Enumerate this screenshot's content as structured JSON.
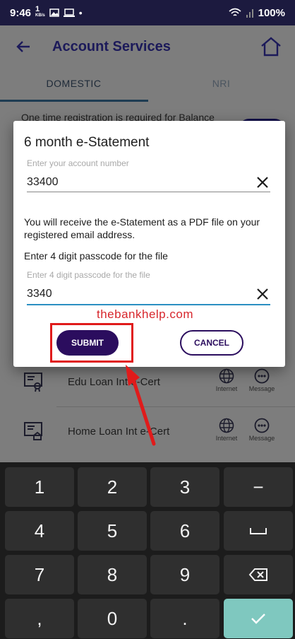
{
  "status_bar": {
    "time": "9:46",
    "speed_unit": "KB/s",
    "battery": "100%"
  },
  "header": {
    "title": "Account Services",
    "back_icon": "back-arrow-icon",
    "home_icon": "home-icon"
  },
  "tabs": [
    {
      "label": "DOMESTIC",
      "active": true
    },
    {
      "label": "NRI",
      "active": false
    }
  ],
  "notice": {
    "text": "One time registration is required for Balance"
  },
  "services": [
    {
      "name": "Edu Loan Int e-Cert",
      "channels": [
        "Internet",
        "Message"
      ]
    },
    {
      "name": "Home Loan Int e-Cert",
      "channels": [
        "Internet",
        "Message"
      ]
    }
  ],
  "dialog": {
    "title": "6 month e-Statement",
    "account_placeholder": "Enter your account number",
    "account_value": "33400",
    "info": "You will receive the e-Statement as a PDF file on your registered email address.",
    "passcode_label": "Enter 4 digit passcode for the file",
    "passcode_placeholder": "Enter 4 digit passcode for the file",
    "passcode_value": "3340",
    "watermark": "thebankhelp.com",
    "submit_label": "SUBMIT",
    "cancel_label": "CANCEL"
  },
  "colors": {
    "accent": "#2b0d5e",
    "header_text": "#1c1a5a",
    "highlight": "#e01b1b",
    "field_active": "#2b8fc2",
    "key_done": "#7fc8bf"
  },
  "keypad": {
    "rows": [
      [
        "1",
        "2",
        "3",
        "−"
      ],
      [
        "4",
        "5",
        "6",
        "space"
      ],
      [
        "7",
        "8",
        "9",
        "backspace"
      ],
      [
        ",",
        "0",
        ".",
        "done"
      ]
    ]
  }
}
